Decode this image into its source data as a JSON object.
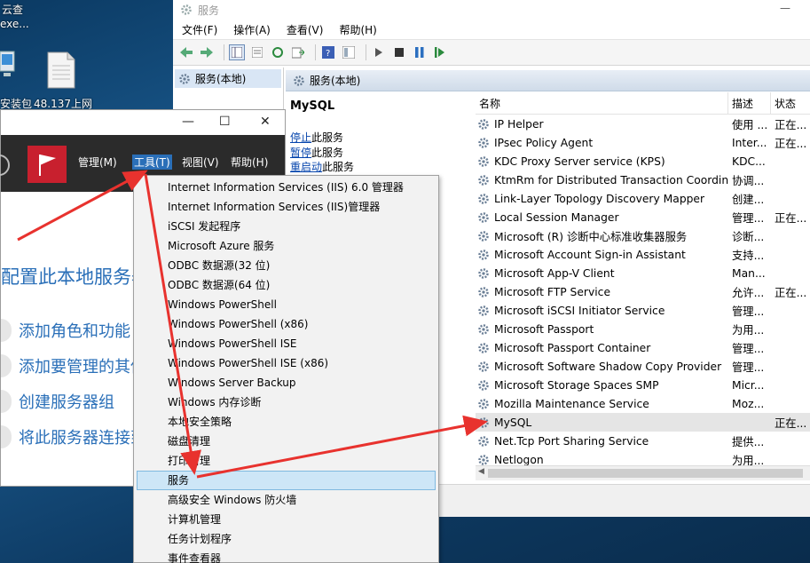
{
  "desktop": {
    "top_label": "云查",
    "top_label2": "exe...",
    "icon1_label": "安装包",
    "icon2_label": "48.137上网"
  },
  "services_window": {
    "title": "服务",
    "menu": [
      "文件(F)",
      "操作(A)",
      "查看(V)",
      "帮助(H)"
    ],
    "tree_item": "服务(本地)",
    "header": "服务(本地)",
    "detail": {
      "service_name": "MySQL",
      "stop_link": "停止",
      "stop_suffix": "此服务",
      "pause_link": "暂停",
      "pause_suffix": "此服务",
      "restart_link": "重启动",
      "restart_suffix": "此服务"
    },
    "columns": {
      "name": "名称",
      "desc": "描述",
      "state": "状态"
    },
    "rows": [
      {
        "name": "IP Helper",
        "desc": "使用 ...",
        "state": "正在..."
      },
      {
        "name": "IPsec Policy Agent",
        "desc": "Inter...",
        "state": "正在..."
      },
      {
        "name": "KDC Proxy Server service (KPS)",
        "desc": "KDC...",
        "state": ""
      },
      {
        "name": "KtmRm for Distributed Transaction Coordin...",
        "desc": "协调...",
        "state": ""
      },
      {
        "name": "Link-Layer Topology Discovery Mapper",
        "desc": "创建...",
        "state": ""
      },
      {
        "name": "Local Session Manager",
        "desc": "管理...",
        "state": "正在..."
      },
      {
        "name": "Microsoft (R) 诊断中心标准收集器服务",
        "desc": "诊断...",
        "state": ""
      },
      {
        "name": "Microsoft Account Sign-in Assistant",
        "desc": "支持...",
        "state": ""
      },
      {
        "name": "Microsoft App-V Client",
        "desc": "Man...",
        "state": ""
      },
      {
        "name": "Microsoft FTP Service",
        "desc": "允许...",
        "state": "正在..."
      },
      {
        "name": "Microsoft iSCSI Initiator Service",
        "desc": "管理...",
        "state": ""
      },
      {
        "name": "Microsoft Passport",
        "desc": "为用...",
        "state": ""
      },
      {
        "name": "Microsoft Passport Container",
        "desc": "管理...",
        "state": ""
      },
      {
        "name": "Microsoft Software Shadow Copy Provider",
        "desc": "管理...",
        "state": ""
      },
      {
        "name": "Microsoft Storage Spaces SMP",
        "desc": "Micr...",
        "state": ""
      },
      {
        "name": "Mozilla Maintenance Service",
        "desc": "Moz...",
        "state": ""
      },
      {
        "name": "MySQL",
        "desc": "",
        "state": "正在..."
      },
      {
        "name": "Net.Tcp Port Sharing Service",
        "desc": "提供...",
        "state": ""
      },
      {
        "name": "Netlogon",
        "desc": "为用...",
        "state": ""
      }
    ]
  },
  "server_manager": {
    "menu": {
      "manage": "管理(M)",
      "tools": "工具(T)",
      "view": "视图(V)",
      "help": "帮助(H)"
    },
    "heading": "配置此本地服务器",
    "tasks": [
      "添加角色和功能",
      "添加要管理的其他服务器",
      "创建服务器组",
      "将此服务器连接到云服务"
    ]
  },
  "tools_menu": {
    "items": [
      "Internet Information Services (IIS) 6.0 管理器",
      "Internet Information Services (IIS)管理器",
      "iSCSI 发起程序",
      "Microsoft Azure 服务",
      "ODBC 数据源(32 位)",
      "ODBC 数据源(64 位)",
      "Windows PowerShell",
      "Windows PowerShell (x86)",
      "Windows PowerShell ISE",
      "Windows PowerShell ISE (x86)",
      "Windows Server Backup",
      "Windows 内存诊断",
      "本地安全策略",
      "磁盘清理",
      "打印管理",
      "服务",
      "高级安全 Windows 防火墙",
      "计算机管理",
      "任务计划程序",
      "事件查看器"
    ],
    "highlighted": "服务"
  },
  "colors": {
    "accent": "#2a6fb8",
    "arrow": "#e8322e",
    "nav_bg": "#2b2b2b",
    "flag": "#c8202e"
  }
}
